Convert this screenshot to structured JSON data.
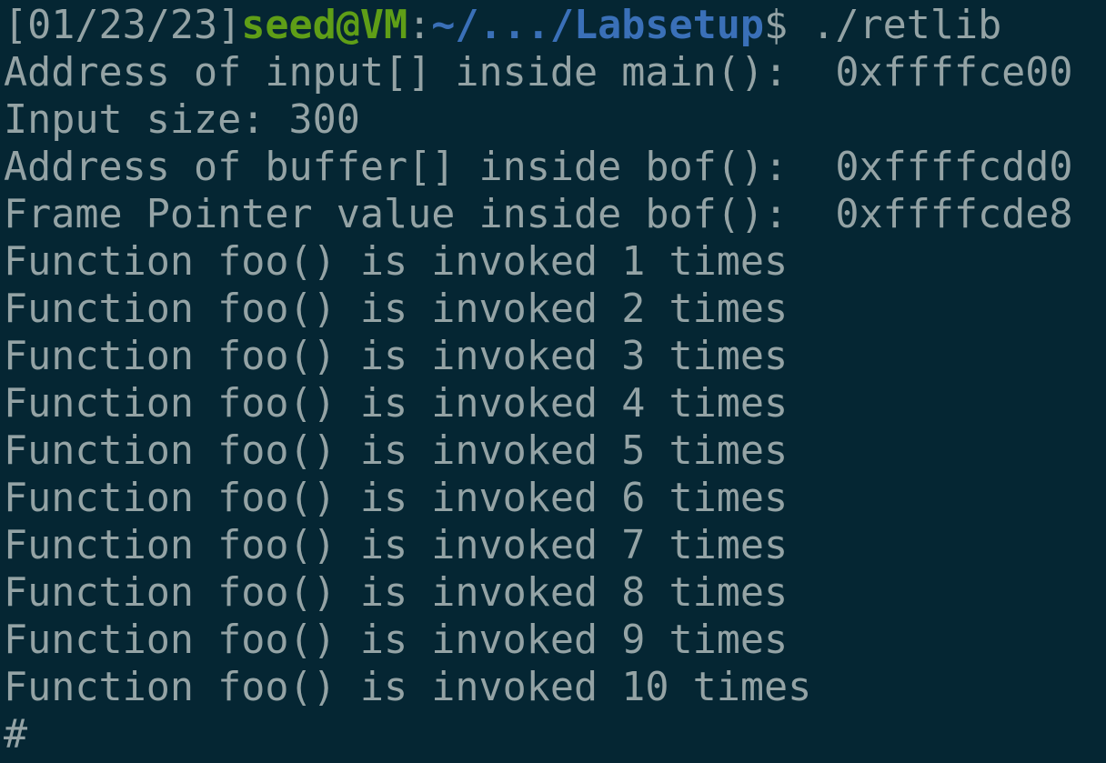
{
  "prompt": {
    "timestamp": "[01/23/23]",
    "user_host": "seed@VM",
    "separator": ":",
    "path": "~/.../Labsetup",
    "symbol": "$",
    "command": " ./retlib"
  },
  "output_lines": [
    "Address of input[] inside main():  0xffffce00",
    "Input size: 300",
    "Address of buffer[] inside bof():  0xffffcdd0",
    "Frame Pointer value inside bof():  0xffffcde8",
    "Function foo() is invoked 1 times",
    "Function foo() is invoked 2 times",
    "Function foo() is invoked 3 times",
    "Function foo() is invoked 4 times",
    "Function foo() is invoked 5 times",
    "Function foo() is invoked 6 times",
    "Function foo() is invoked 7 times",
    "Function foo() is invoked 8 times",
    "Function foo() is invoked 9 times",
    "Function foo() is invoked 10 times"
  ],
  "root_prompt": "#",
  "colors": {
    "background": "#052633",
    "text": "#94a3a5",
    "user_host": "#5f9e17",
    "path": "#3a70b8"
  }
}
